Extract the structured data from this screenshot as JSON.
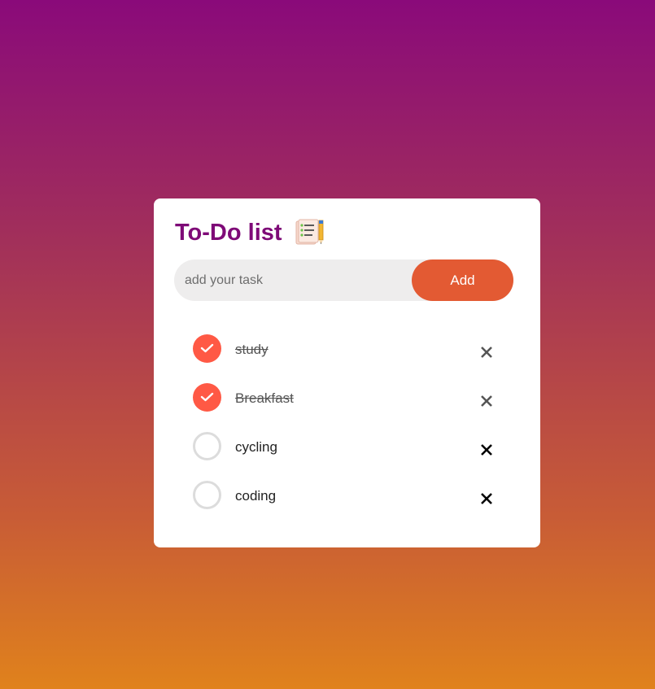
{
  "header": {
    "title": "To-Do list",
    "icon": "notepad-with-pencil-icon"
  },
  "input": {
    "placeholder": "add your task",
    "value": ""
  },
  "add_button": {
    "label": "Add",
    "color": "#e35a33"
  },
  "tasks": [
    {
      "text": "study",
      "done": true
    },
    {
      "text": "Breakfast",
      "done": true
    },
    {
      "text": "cycling",
      "done": false
    },
    {
      "text": "coding",
      "done": false
    }
  ],
  "colors": {
    "title": "#7e0a77",
    "check_done": "#ff5945",
    "gradient_top": "#8a0a7a",
    "gradient_bottom": "#e0821c"
  }
}
